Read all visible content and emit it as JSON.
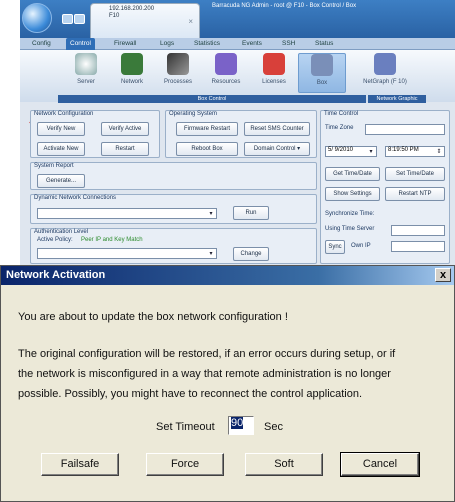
{
  "titlebar": {
    "tab_ip": "192.168.200.200",
    "tab_fw": "F10",
    "window_title": "Barracuda NG Admin - root @ F10 - Box Control / Box"
  },
  "menu": [
    "Config",
    "Control",
    "Firewall",
    "Logs",
    "Statistics",
    "Events",
    "SSH",
    "Status"
  ],
  "ribbon": {
    "items": [
      "Server",
      "Network",
      "Processes",
      "Resources",
      "Licenses",
      "Box",
      "NetGraph (F 10)"
    ],
    "footer_left": "Box Control",
    "footer_right": "Network Graphic"
  },
  "network_config": {
    "label": "Network Configuration",
    "verify_new": "Verify New",
    "verify_active": "Verify Active",
    "activate_new": "Activate New",
    "restart": "Restart"
  },
  "operating_system": {
    "label": "Operating System",
    "firmware_restart": "Firmware Restart",
    "reset_sms": "Reset SMS Counter",
    "reboot": "Reboot Box",
    "domain_control": "Domain Control"
  },
  "system_report": {
    "label": "System Report",
    "generate": "Generate..."
  },
  "dynamic_network": {
    "label": "Dynamic Network Connections",
    "run": "Run"
  },
  "auth": {
    "label": "Authentication Level",
    "active_policy_label": "Active Policy:",
    "active_policy_value": "Peer IP and Key Match",
    "change": "Change"
  },
  "time_control": {
    "label": "Time Control",
    "time_zone": "Time Zone",
    "date": "5/ 9/2010",
    "time": "8:19:50 PM",
    "get_time": "Get Time/Date",
    "set_time": "Set Time/Date",
    "show_settings": "Show Settings",
    "restart_ntp": "Restart NTP",
    "sync_label": "Synchronize Time:",
    "using_server": "Using Time Server",
    "sync": "Sync",
    "own_ip": "Own IP"
  },
  "dialog": {
    "title": "Network Activation",
    "line1": "You are about to update the box network configuration !",
    "line2": "The original configuration will be restored, if an error occurs during setup, or if",
    "line3": "the network is misconfigured in a way that remote administration is no longer",
    "line4": "possible. Possibly, you might have to reconnect the control application.",
    "timeout_label": "Set Timeout",
    "timeout_value": "90",
    "timeout_unit": "Sec",
    "failsafe": "Failsafe",
    "force": "Force",
    "soft": "Soft",
    "cancel": "Cancel",
    "close_glyph": "x"
  }
}
